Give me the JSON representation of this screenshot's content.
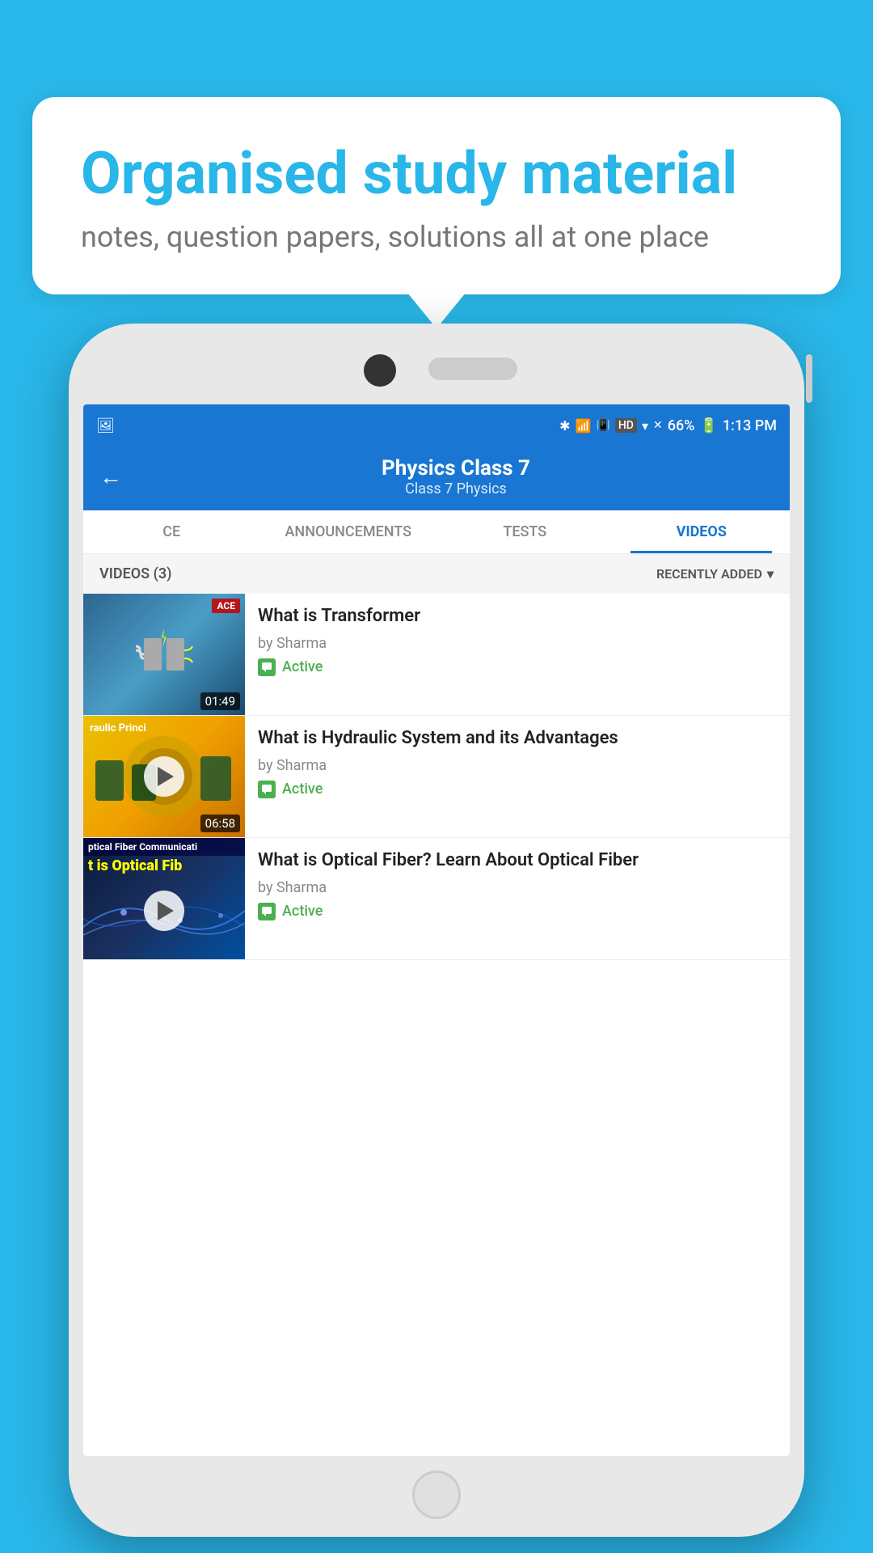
{
  "background_color": "#29b6e8",
  "bubble": {
    "title": "Organised study material",
    "subtitle": "notes, question papers, solutions all at one place"
  },
  "status_bar": {
    "time": "1:13 PM",
    "battery": "66%",
    "icons": "bluetooth signal hd wifi data"
  },
  "header": {
    "back_label": "←",
    "title": "Physics Class 7",
    "breadcrumb": "Class 7    Physics"
  },
  "tabs": [
    {
      "label": "CE",
      "active": false
    },
    {
      "label": "ANNOUNCEMENTS",
      "active": false
    },
    {
      "label": "TESTS",
      "active": false
    },
    {
      "label": "VIDEOS",
      "active": true
    }
  ],
  "filter_bar": {
    "count_label": "VIDEOS (3)",
    "sort_label": "RECENTLY ADDED"
  },
  "videos": [
    {
      "title": "What is  Transformer",
      "author": "by Sharma",
      "status": "Active",
      "duration": "01:49",
      "thumb_label": "ACE"
    },
    {
      "title": "What is Hydraulic System and its Advantages",
      "author": "by Sharma",
      "status": "Active",
      "duration": "06:58",
      "thumb_overlay": "raulic Princi"
    },
    {
      "title": "What is Optical Fiber? Learn About Optical Fiber",
      "author": "by Sharma",
      "status": "Active",
      "duration": "",
      "thumb_overlay_top": "ptical Fiber Communicati",
      "thumb_overlay_large": "t is Optical Fib"
    }
  ]
}
